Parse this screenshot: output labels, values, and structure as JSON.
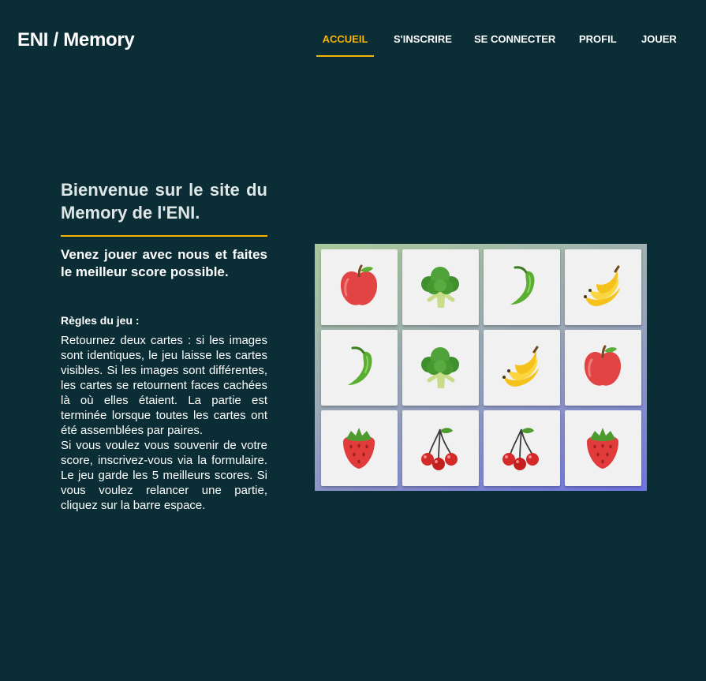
{
  "header": {
    "brand": "ENI / Memory",
    "nav": [
      {
        "label": "ACCUEIL",
        "active": true
      },
      {
        "label": "S'INSCRIRE",
        "active": false
      },
      {
        "label": "SE CONNECTER",
        "active": false
      },
      {
        "label": "PROFIL",
        "active": false
      },
      {
        "label": "JOUER",
        "active": false
      }
    ]
  },
  "intro": {
    "title": "Bienvenue sur le site du Memory de l'ENI.",
    "subtitle": "Venez jouer avec nous et faites le meilleur score possible.",
    "rules_title": "Règles du jeu :",
    "rules_text_1": "Retournez deux cartes : si les images sont identiques, le jeu laisse les cartes visibles. Si les images sont différentes, les cartes se retournent faces cachées là où elles étaient. La partie est terminée lorsque toutes les cartes ont été assemblées par paires.",
    "rules_text_2": "Si vous voulez vous souvenir de votre score, inscrivez-vous via la formulaire. Le jeu garde les 5 meilleurs scores. Si vous voulez relancer une partie, cliquez sur la barre espace."
  },
  "board": {
    "rows": [
      [
        "apple-icon",
        "broccoli-icon",
        "chili-icon",
        "banana-icon"
      ],
      [
        "chili-icon",
        "broccoli-icon",
        "banana-icon",
        "apple-icon"
      ],
      [
        "strawberry-icon",
        "cherry-icon",
        "cherry-icon",
        "strawberry-icon"
      ]
    ]
  },
  "colors": {
    "background": "#0b2d35",
    "accent": "#f6b400",
    "card": "#f1f1f1"
  }
}
